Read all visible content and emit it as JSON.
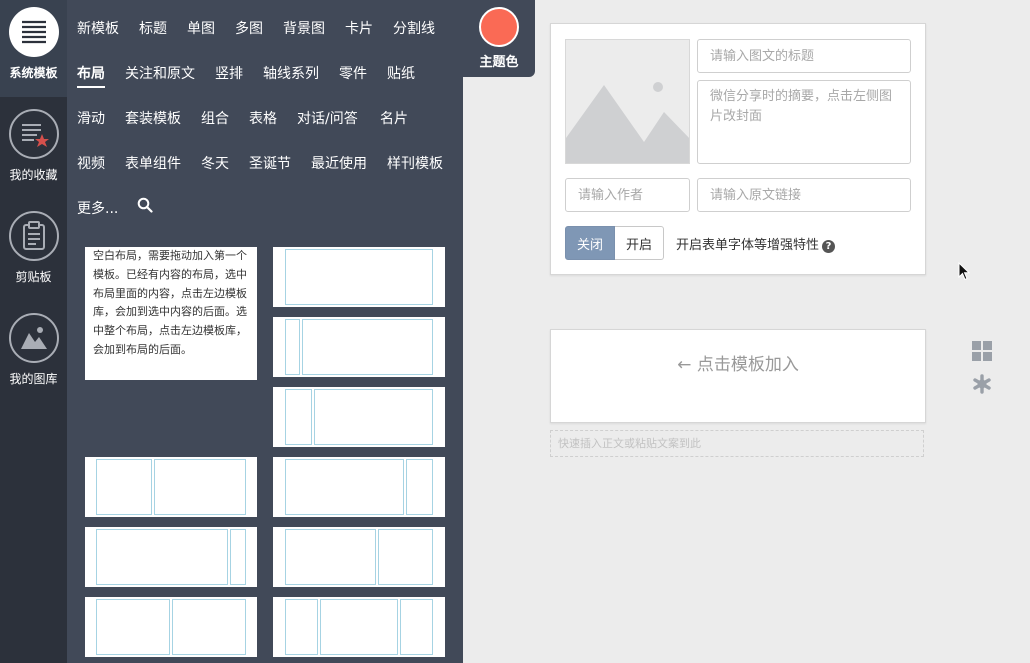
{
  "rail": {
    "items": [
      {
        "label": "系统模板",
        "icon": "list-lines-icon",
        "active": true
      },
      {
        "label": "我的收藏",
        "icon": "favorites-star-icon"
      },
      {
        "label": "剪贴板",
        "icon": "clipboard-icon"
      },
      {
        "label": "我的图库",
        "icon": "image-library-icon"
      }
    ]
  },
  "categories": {
    "row1": [
      "新模板",
      "标题",
      "单图",
      "多图",
      "背景图",
      "卡片",
      "分割线"
    ],
    "row2": [
      "布局",
      "关注和原文",
      "竖排",
      "轴线系列",
      "零件",
      "贴纸"
    ],
    "row3": [
      "滑动",
      "套装模板",
      "组合",
      "表格",
      "对话/问答",
      "名片"
    ],
    "row4": [
      "视频",
      "表单组件",
      "冬天",
      "圣诞节",
      "最近使用",
      "样刊模板"
    ],
    "more": "更多...",
    "active": "布局"
  },
  "hint": {
    "text": "空白布局，需要拖动加入第一个模板。已经有内容的布局，选中布局里面的内容，点击左边模板库，会加到选中内容的后面。选中整个布局，点击左边模板库，会加到布局的后面。"
  },
  "theme": {
    "label": "主题色",
    "color": "#fa6a55"
  },
  "article": {
    "title_placeholder": "请输入图文的标题",
    "summary_placeholder": "微信分享时的摘要，点击左侧图片改封面",
    "author_placeholder": "请输入作者",
    "link_placeholder": "请输入原文链接",
    "toggle_off": "关闭",
    "toggle_on": "开启",
    "enhance_label": "开启表单字体等增强特性",
    "help": "?"
  },
  "editor": {
    "add_label": "← 点击模板加入",
    "quick_insert": "快速插入正文或粘贴文案到此"
  },
  "colors": {
    "rail_bg": "#2c313b",
    "panel_bg": "#414958",
    "accent": "#7f97b5",
    "layout_border": "#a6d3e3"
  }
}
